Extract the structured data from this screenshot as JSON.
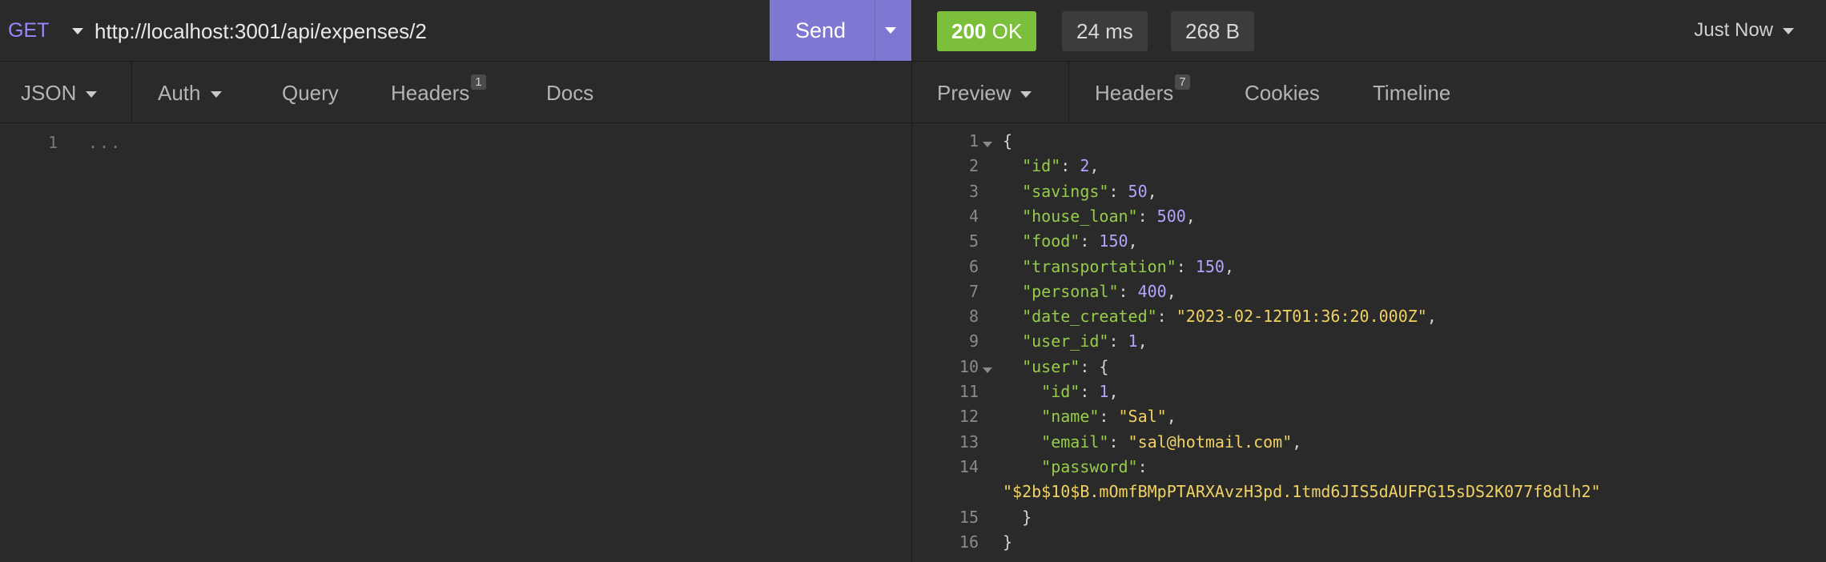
{
  "request": {
    "method": "GET",
    "url": "http://localhost:3001/api/expenses/2",
    "send_label": "Send",
    "tabs": {
      "body_label": "JSON",
      "auth_label": "Auth",
      "query_label": "Query",
      "headers_label": "Headers",
      "headers_count": "1",
      "docs_label": "Docs"
    },
    "body": {
      "line_number": "1",
      "placeholder": "..."
    }
  },
  "response": {
    "status_code": "200",
    "status_text": "OK",
    "time": "24 ms",
    "size": "268 B",
    "history_label": "Just Now",
    "tabs": {
      "preview_label": "Preview",
      "headers_label": "Headers",
      "headers_count": "7",
      "cookies_label": "Cookies",
      "timeline_label": "Timeline"
    },
    "lines": [
      {
        "num": "1",
        "fold": true,
        "segs": [
          {
            "t": "p",
            "v": "{"
          }
        ]
      },
      {
        "num": "2",
        "segs": [
          {
            "t": "k",
            "v": "  \"id\""
          },
          {
            "t": "p",
            "v": ": "
          },
          {
            "t": "n",
            "v": "2"
          },
          {
            "t": "p",
            "v": ","
          }
        ]
      },
      {
        "num": "3",
        "segs": [
          {
            "t": "k",
            "v": "  \"savings\""
          },
          {
            "t": "p",
            "v": ": "
          },
          {
            "t": "n",
            "v": "50"
          },
          {
            "t": "p",
            "v": ","
          }
        ]
      },
      {
        "num": "4",
        "segs": [
          {
            "t": "k",
            "v": "  \"house_loan\""
          },
          {
            "t": "p",
            "v": ": "
          },
          {
            "t": "n",
            "v": "500"
          },
          {
            "t": "p",
            "v": ","
          }
        ]
      },
      {
        "num": "5",
        "segs": [
          {
            "t": "k",
            "v": "  \"food\""
          },
          {
            "t": "p",
            "v": ": "
          },
          {
            "t": "n",
            "v": "150"
          },
          {
            "t": "p",
            "v": ","
          }
        ]
      },
      {
        "num": "6",
        "segs": [
          {
            "t": "k",
            "v": "  \"transportation\""
          },
          {
            "t": "p",
            "v": ": "
          },
          {
            "t": "n",
            "v": "150"
          },
          {
            "t": "p",
            "v": ","
          }
        ]
      },
      {
        "num": "7",
        "segs": [
          {
            "t": "k",
            "v": "  \"personal\""
          },
          {
            "t": "p",
            "v": ": "
          },
          {
            "t": "n",
            "v": "400"
          },
          {
            "t": "p",
            "v": ","
          }
        ]
      },
      {
        "num": "8",
        "segs": [
          {
            "t": "k",
            "v": "  \"date_created\""
          },
          {
            "t": "p",
            "v": ": "
          },
          {
            "t": "s",
            "v": "\"2023-02-12T01:36:20.000Z\""
          },
          {
            "t": "p",
            "v": ","
          }
        ]
      },
      {
        "num": "9",
        "segs": [
          {
            "t": "k",
            "v": "  \"user_id\""
          },
          {
            "t": "p",
            "v": ": "
          },
          {
            "t": "n",
            "v": "1"
          },
          {
            "t": "p",
            "v": ","
          }
        ]
      },
      {
        "num": "10",
        "fold": true,
        "segs": [
          {
            "t": "k",
            "v": "  \"user\""
          },
          {
            "t": "p",
            "v": ": {"
          }
        ]
      },
      {
        "num": "11",
        "segs": [
          {
            "t": "k",
            "v": "    \"id\""
          },
          {
            "t": "p",
            "v": ": "
          },
          {
            "t": "n",
            "v": "1"
          },
          {
            "t": "p",
            "v": ","
          }
        ]
      },
      {
        "num": "12",
        "segs": [
          {
            "t": "k",
            "v": "    \"name\""
          },
          {
            "t": "p",
            "v": ": "
          },
          {
            "t": "s",
            "v": "\"Sal\""
          },
          {
            "t": "p",
            "v": ","
          }
        ]
      },
      {
        "num": "13",
        "segs": [
          {
            "t": "k",
            "v": "    \"email\""
          },
          {
            "t": "p",
            "v": ": "
          },
          {
            "t": "s",
            "v": "\"sal@hotmail.com\""
          },
          {
            "t": "p",
            "v": ","
          }
        ]
      },
      {
        "num": "14",
        "segs": [
          {
            "t": "k",
            "v": "    \"password\""
          },
          {
            "t": "p",
            "v": ":"
          }
        ]
      },
      {
        "num": "",
        "segs": [
          {
            "t": "s",
            "v": "\"$2b$10$B.mOmfBMpPTARXAvzH3pd.1tmd6JIS5dAUFPG15sDS2K077f8dlh2\""
          }
        ]
      },
      {
        "num": "15",
        "segs": [
          {
            "t": "p",
            "v": "  }"
          }
        ]
      },
      {
        "num": "16",
        "segs": [
          {
            "t": "p",
            "v": "}"
          }
        ]
      }
    ]
  },
  "colors": {
    "accent_send": "#7e78d2",
    "status_ok": "#7bbf3a",
    "json_key": "#96cc4c",
    "json_number": "#b3a4ff",
    "json_string": "#f0d264",
    "method_get": "#a084ff"
  },
  "icons": {
    "dropdown": "chevron-down-icon",
    "fold": "fold-caret-icon"
  }
}
